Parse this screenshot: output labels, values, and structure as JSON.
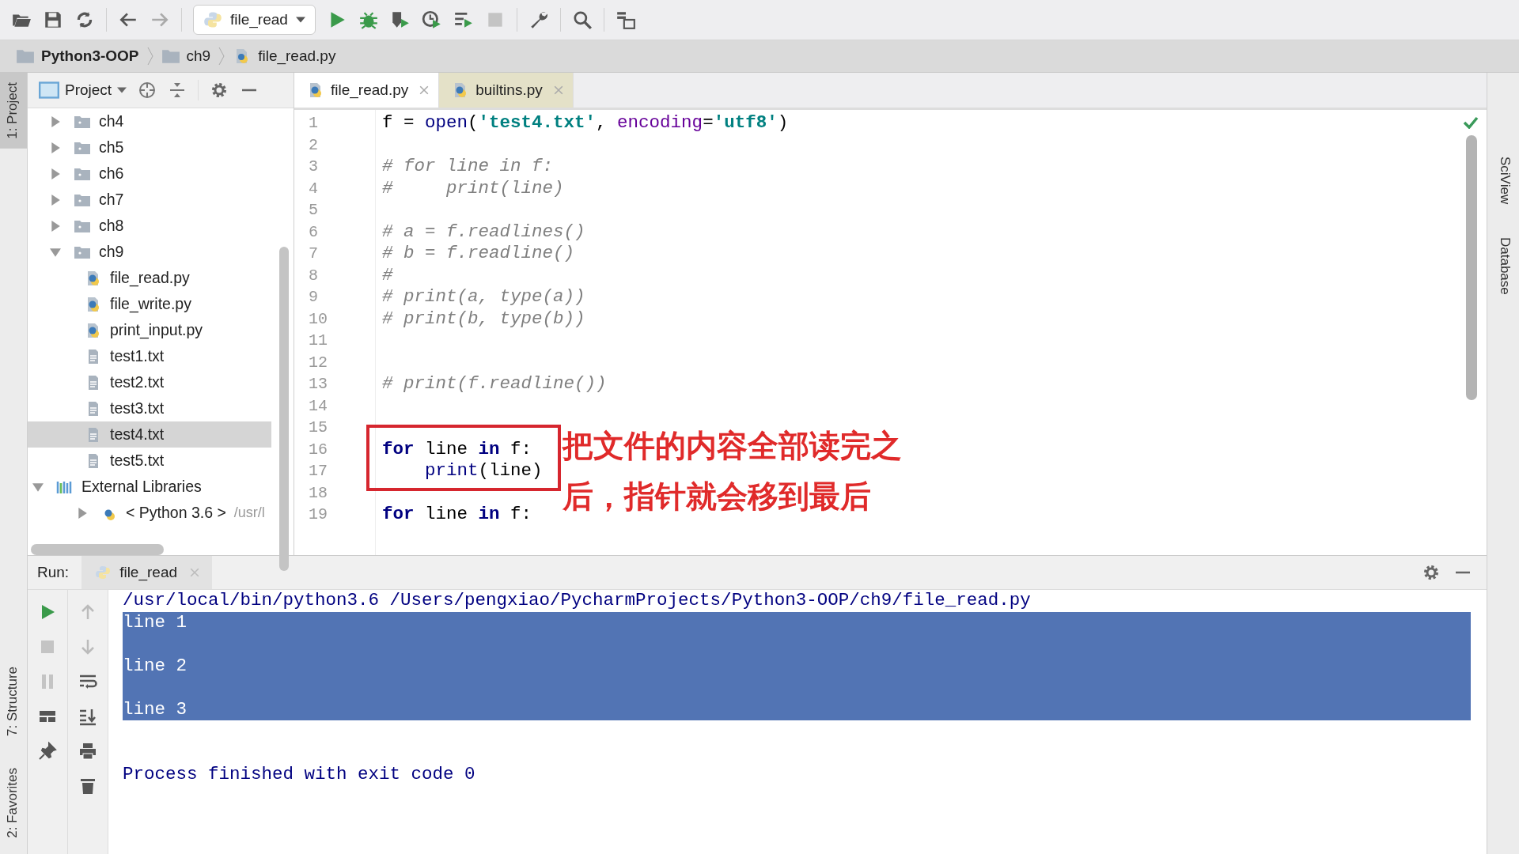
{
  "toolbar": {
    "run_config": "file_read"
  },
  "breadcrumb": [
    {
      "label": "Python3-OOP",
      "kind": "folder",
      "bold": true
    },
    {
      "label": "ch9",
      "kind": "folder",
      "bold": false
    },
    {
      "label": "file_read.py",
      "kind": "python",
      "bold": false
    }
  ],
  "left_strip": [
    {
      "label": "1: Project",
      "selected": true
    },
    {
      "label": "7: Structure",
      "selected": false
    },
    {
      "label": "2: Favorites",
      "selected": false
    }
  ],
  "right_strip": [
    "SciView",
    "Database"
  ],
  "project": {
    "title": "Project",
    "tree": [
      {
        "label": "ch4",
        "kind": "folder",
        "expanded": false,
        "selected": false
      },
      {
        "label": "ch5",
        "kind": "folder",
        "expanded": false,
        "selected": false
      },
      {
        "label": "ch6",
        "kind": "folder",
        "expanded": false,
        "selected": false
      },
      {
        "label": "ch7",
        "kind": "folder",
        "expanded": false,
        "selected": false
      },
      {
        "label": "ch8",
        "kind": "folder",
        "expanded": false,
        "selected": false
      },
      {
        "label": "ch9",
        "kind": "folder",
        "expanded": true,
        "selected": false,
        "children": [
          {
            "label": "file_read.py",
            "kind": "python",
            "selected": false
          },
          {
            "label": "file_write.py",
            "kind": "python",
            "selected": false
          },
          {
            "label": "print_input.py",
            "kind": "python",
            "selected": false
          },
          {
            "label": "test1.txt",
            "kind": "text",
            "selected": false
          },
          {
            "label": "test2.txt",
            "kind": "text",
            "selected": false
          },
          {
            "label": "test3.txt",
            "kind": "text",
            "selected": false
          },
          {
            "label": "test4.txt",
            "kind": "text",
            "selected": true
          },
          {
            "label": "test5.txt",
            "kind": "text",
            "selected": false
          }
        ]
      },
      {
        "label": "External Libraries",
        "kind": "library",
        "expanded": true,
        "selected": false,
        "children": [
          {
            "label": "< Python 3.6 >",
            "kind": "python-sdk",
            "expanded": false,
            "selected": false,
            "hint": "/usr/l"
          }
        ]
      }
    ]
  },
  "editor": {
    "tabs": [
      {
        "label": "file_read.py",
        "selected": true
      },
      {
        "label": "builtins.py",
        "selected": false
      }
    ],
    "lines": [
      {
        "number": "1",
        "tokens": [
          {
            "text": "f = ",
            "kind": "plain"
          },
          {
            "text": "open",
            "kind": "builtin"
          },
          {
            "text": "(",
            "kind": "plain"
          },
          {
            "text": "'test4.txt'",
            "kind": "str"
          },
          {
            "text": ", ",
            "kind": "plain"
          },
          {
            "text": "encoding",
            "kind": "param"
          },
          {
            "text": "=",
            "kind": "plain"
          },
          {
            "text": "'utf8'",
            "kind": "str"
          },
          {
            "text": ")",
            "kind": "plain"
          }
        ]
      },
      {
        "number": "2"
      },
      {
        "number": "3",
        "tokens": [
          {
            "text": "# for line in f:",
            "kind": "com"
          }
        ]
      },
      {
        "number": "4",
        "tokens": [
          {
            "text": "#     print(line)",
            "kind": "com"
          }
        ]
      },
      {
        "number": "5"
      },
      {
        "number": "6",
        "tokens": [
          {
            "text": "# a = f.readlines()",
            "kind": "com"
          }
        ]
      },
      {
        "number": "7",
        "tokens": [
          {
            "text": "# b = f.readline()",
            "kind": "com"
          }
        ]
      },
      {
        "number": "8",
        "tokens": [
          {
            "text": "#",
            "kind": "com"
          }
        ]
      },
      {
        "number": "9",
        "tokens": [
          {
            "text": "# print(a, type(a))",
            "kind": "com"
          }
        ]
      },
      {
        "number": "10",
        "tokens": [
          {
            "text": "# print(b, type(b))",
            "kind": "com"
          }
        ]
      },
      {
        "number": "11"
      },
      {
        "number": "12"
      },
      {
        "number": "13",
        "tokens": [
          {
            "text": "# print(f.readline())",
            "kind": "com"
          }
        ]
      },
      {
        "number": "14"
      },
      {
        "number": "15"
      },
      {
        "number": "16",
        "tokens": [
          {
            "text": "for",
            "kind": "kw"
          },
          {
            "text": " line ",
            "kind": "plain"
          },
          {
            "text": "in",
            "kind": "kw"
          },
          {
            "text": " f:",
            "kind": "plain"
          }
        ]
      },
      {
        "number": "17",
        "tokens": [
          {
            "text": "    print",
            "kind": "builtin"
          },
          {
            "text": "(line)",
            "kind": "plain"
          }
        ]
      },
      {
        "number": "18"
      },
      {
        "number": "19",
        "tokens": [
          {
            "text": "for",
            "kind": "kw"
          },
          {
            "text": " line ",
            "kind": "plain"
          },
          {
            "text": "in",
            "kind": "kw"
          },
          {
            "text": " f:",
            "kind": "plain"
          }
        ]
      }
    ],
    "annotation": [
      "把文件的内容全部读完之",
      "后，指针就会移到最后"
    ]
  },
  "run": {
    "label": "Run:",
    "tab": "file_read",
    "output": [
      {
        "text": "/usr/local/bin/python3.6 /Users/pengxiao/PycharmProjects/Python3-OOP/ch9/file_read.py",
        "selected": false
      },
      {
        "text": "line 1",
        "selected": true
      },
      {
        "text": "line 2",
        "selected": true
      },
      {
        "text": "line 3",
        "selected": true
      },
      {
        "text": "Process finished with exit code 0",
        "selected": false
      }
    ]
  }
}
